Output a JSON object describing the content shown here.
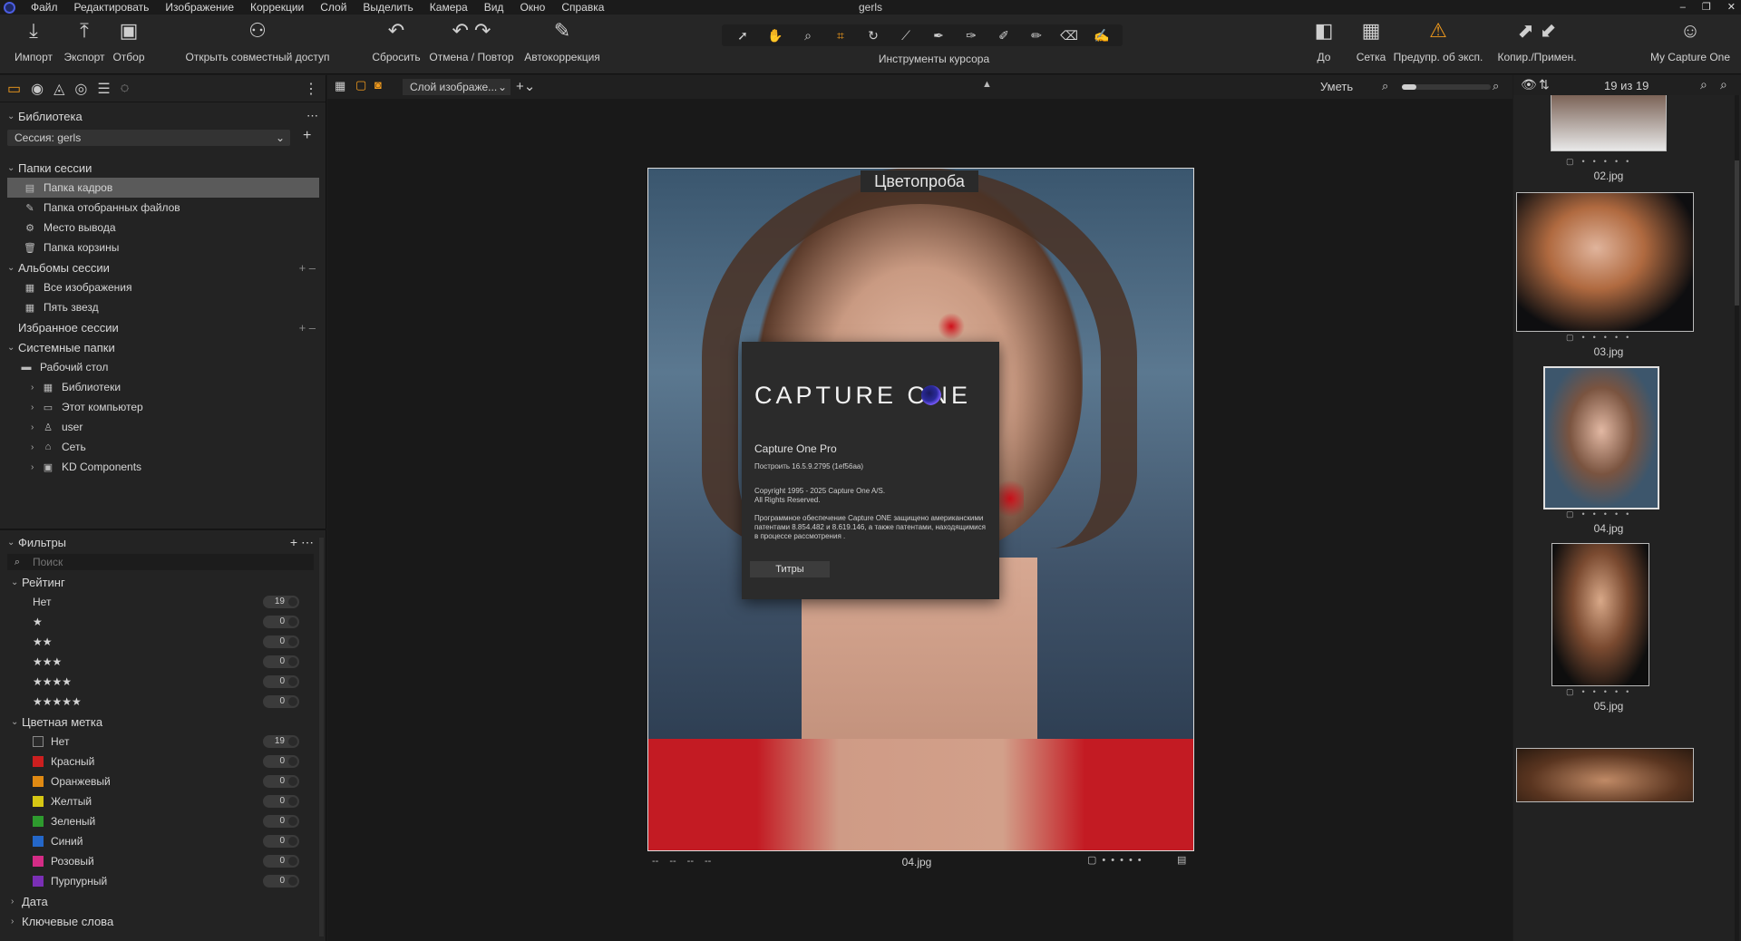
{
  "window": {
    "title": "gerls"
  },
  "menu": [
    "Файл",
    "Редактировать",
    "Изображение",
    "Коррекции",
    "Слой",
    "Выделить",
    "Камера",
    "Вид",
    "Окно",
    "Справка"
  ],
  "toolbar": {
    "import": "Импорт",
    "export": "Экспорт",
    "select": "Отбор",
    "share": "Открыть совместный доступ",
    "reset": "Сбросить",
    "undo_redo": "Отмена / Повтор",
    "autocorrect": "Автокоррекция",
    "cursor_tools": "Инструменты курсора",
    "before": "До",
    "grid": "Сетка",
    "exposure_warning": "Предупр. об эксп.",
    "copy_apply": "Копир./Примен.",
    "my_capture_one": "My Capture One"
  },
  "library": {
    "title": "Библиотека",
    "session_select": "Сессия: gerls",
    "session_folders": {
      "title": "Папки сессии",
      "items": [
        "Папка кадров",
        "Папка отобранных файлов",
        "Место вывода",
        "Папка корзины"
      ]
    },
    "session_albums": {
      "title": "Альбомы сессии",
      "items": [
        "Все изображения",
        "Пять звезд"
      ]
    },
    "session_favorites": {
      "title": "Избранное сессии"
    },
    "system_folders": {
      "title": "Системные папки",
      "root": "Рабочий стол",
      "items": [
        "Библиотеки",
        "Этот компьютер",
        "user",
        "Сеть",
        "KD Components"
      ]
    }
  },
  "filters": {
    "title": "Фильтры",
    "search_placeholder": "Поиск",
    "rating": {
      "title": "Рейтинг",
      "items": [
        {
          "label": "Нет",
          "count": "19"
        },
        {
          "label": "★",
          "count": "0"
        },
        {
          "label": "★★",
          "count": "0"
        },
        {
          "label": "★★★",
          "count": "0"
        },
        {
          "label": "★★★★",
          "count": "0"
        },
        {
          "label": "★★★★★",
          "count": "0"
        }
      ]
    },
    "color_label": {
      "title": "Цветная метка",
      "items": [
        {
          "label": "Нет",
          "count": "19",
          "color": "#2a2a2a"
        },
        {
          "label": "Красный",
          "count": "0",
          "color": "#cc1f1f"
        },
        {
          "label": "Оранжевый",
          "count": "0",
          "color": "#e08a13"
        },
        {
          "label": "Желтый",
          "count": "0",
          "color": "#d6c714"
        },
        {
          "label": "Зеленый",
          "count": "0",
          "color": "#2e9a2e"
        },
        {
          "label": "Синий",
          "count": "0",
          "color": "#2467c9"
        },
        {
          "label": "Розовый",
          "count": "0",
          "color": "#d42c86"
        },
        {
          "label": "Пурпурный",
          "count": "0",
          "color": "#7a2fb5"
        }
      ]
    },
    "date": "Дата",
    "keywords": "Ключевые слова"
  },
  "viewer": {
    "layer_select": "Слой изображе...",
    "fit": "Уметь",
    "overlay_label": "Цветопроба",
    "filename": "04.jpg",
    "meta": [
      "--",
      "--",
      "--",
      "--"
    ]
  },
  "about": {
    "brand": "CAPTURE ONE",
    "product": "Capture One Pro",
    "build": "Построить 16.5.9.2795 (1ef56aa)",
    "copyright": "Copyright 1995 - 2025 Capture One A/S.",
    "rights": "All Rights Reserved.",
    "patents": "Программное обеспечение Capture ONE защищено американскими патентами 8.854.482 и 8.619.146, а также патентами, находящимися в процессе рассмотрения .",
    "credits_button": "Титры"
  },
  "browser": {
    "counter": "19 из 19",
    "thumbs": [
      {
        "name": "02.jpg"
      },
      {
        "name": "03.jpg"
      },
      {
        "name": "04.jpg"
      },
      {
        "name": "05.jpg"
      }
    ]
  }
}
